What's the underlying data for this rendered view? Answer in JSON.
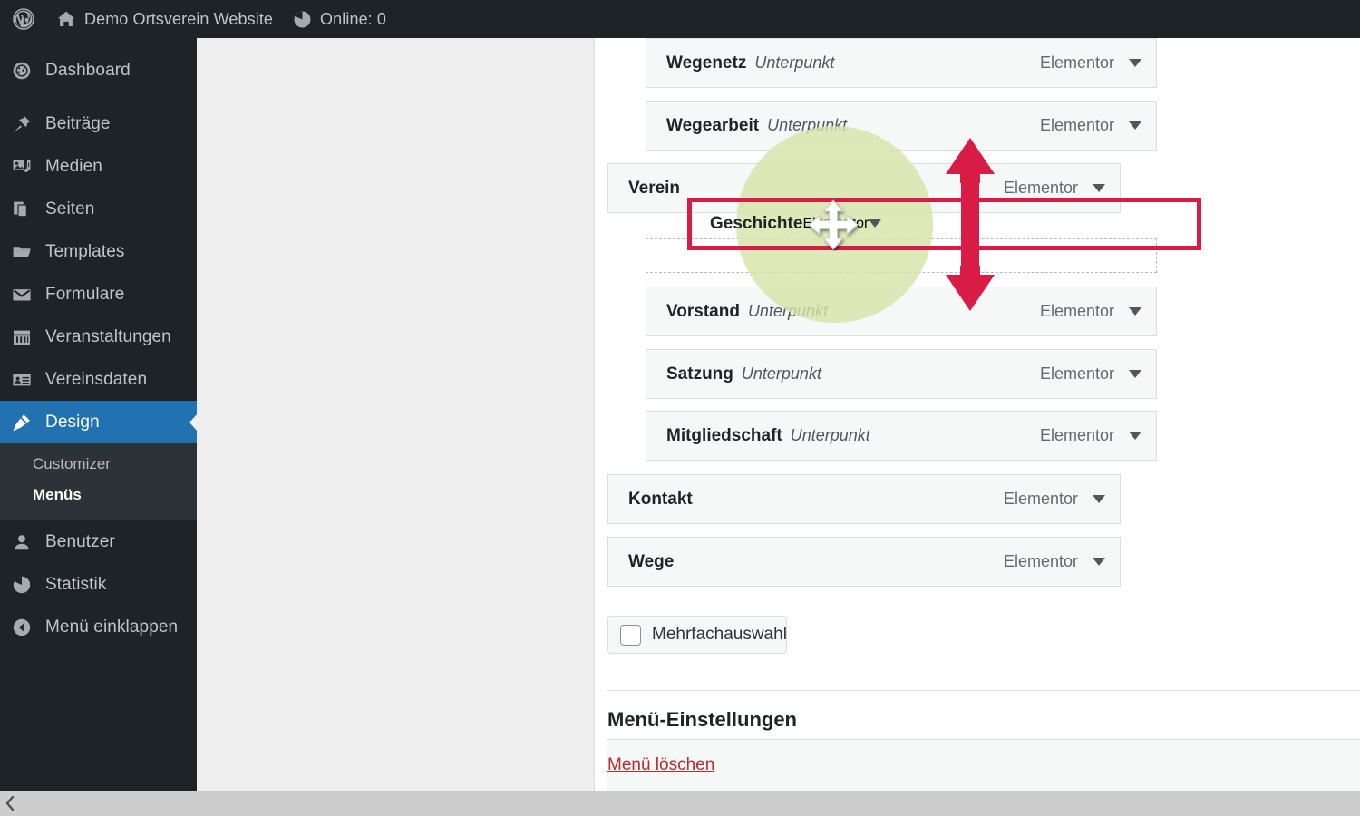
{
  "adminbar": {
    "wp_logo_icon": "wordpress-icon",
    "site_icon": "home-icon",
    "site_name": "Demo Ortsverein Website",
    "online_icon": "pie-chart-icon",
    "online_label": "Online: 0"
  },
  "sidebar": {
    "items": [
      {
        "label": "Dashboard",
        "icon": "dashboard-icon"
      },
      {
        "label": "Beiträge",
        "icon": "pin-icon"
      },
      {
        "label": "Medien",
        "icon": "media-icon"
      },
      {
        "label": "Seiten",
        "icon": "pages-icon"
      },
      {
        "label": "Templates",
        "icon": "folder-icon"
      },
      {
        "label": "Formulare",
        "icon": "envelope-icon"
      },
      {
        "label": "Veranstaltungen",
        "icon": "calendar-icon"
      },
      {
        "label": "Vereinsdaten",
        "icon": "id-card-icon"
      },
      {
        "label": "Design",
        "icon": "paintbrush-icon"
      }
    ],
    "design_submenu": [
      {
        "label": "Customizer",
        "active": false
      },
      {
        "label": "Menüs",
        "active": true
      }
    ],
    "items_after": [
      {
        "label": "Benutzer",
        "icon": "user-icon"
      },
      {
        "label": "Statistik",
        "icon": "pie-chart-icon"
      },
      {
        "label": "Menü einklappen",
        "icon": "collapse-arrow-icon"
      }
    ]
  },
  "menu_structure": {
    "source_label": "Elementor",
    "toggle_icon": "chevron-down-icon",
    "rows": [
      {
        "title": "Wegenetz",
        "type": "Unterpunkt",
        "level": 1
      },
      {
        "title": "Wegearbeit",
        "type": "Unterpunkt",
        "level": 1
      },
      {
        "title": "Verein",
        "type": "",
        "level": 0
      },
      {
        "title": "Vorstand",
        "type": "Unterpunkt",
        "level": 1
      },
      {
        "title": "Satzung",
        "type": "Unterpunkt",
        "level": 1
      },
      {
        "title": "Mitgliedschaft",
        "type": "Unterpunkt",
        "level": 1
      },
      {
        "title": "Kontakt",
        "type": "",
        "level": 0
      },
      {
        "title": "Wege",
        "type": "",
        "level": 0
      }
    ],
    "dragged_row": {
      "title": "Geschichte",
      "source_label": "Elementor",
      "toggle_icon": "chevron-down-icon",
      "cursor_icon": "move-cursor-icon"
    }
  },
  "bulk_select": {
    "label": "Mehrfachauswahl",
    "checked": false
  },
  "settings": {
    "title": "Menü-Einstellungen",
    "delete_link": "Menü löschen"
  },
  "annotation": {
    "highlight_color": "#d7e4ab",
    "box_color": "#d81c45",
    "arrow_icon": "double-arrow-vertical-icon"
  },
  "scrollbar": {
    "left_arrow_icon": "chevron-left-icon"
  }
}
